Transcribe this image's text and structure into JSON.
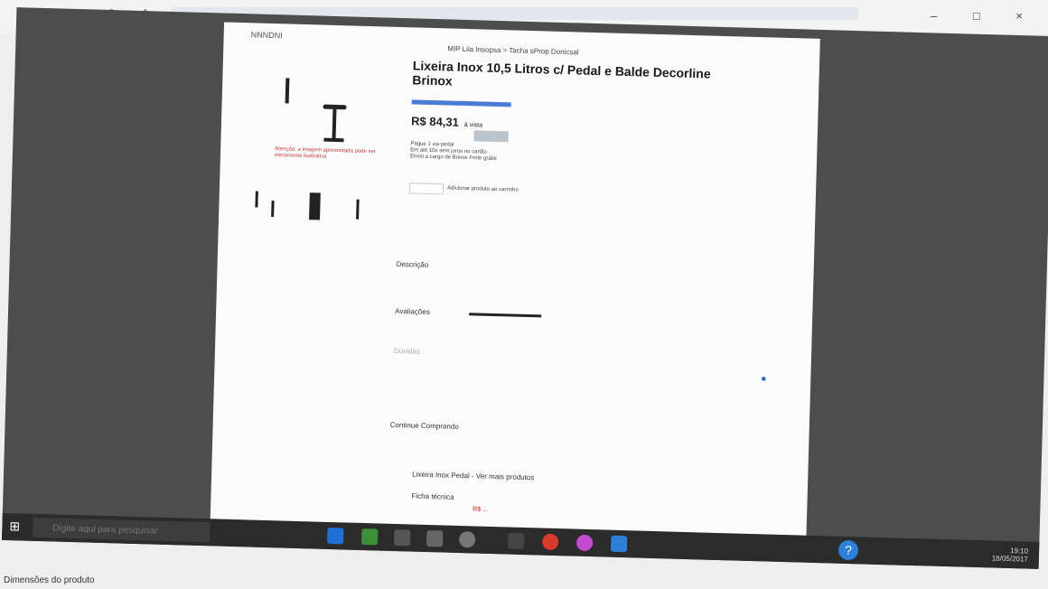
{
  "browser": {
    "reload_icon": "refresh-icon",
    "home_icon": "home-icon",
    "window_controls": [
      "–",
      "□",
      "×"
    ],
    "toolbar_icons": [
      "☆",
      "≡",
      "✎",
      "⇧",
      "…"
    ]
  },
  "page": {
    "header_left": "NNNDNI",
    "breadcrumb": "MIP Lila Insopsa > Tacha sProp Donicsal",
    "title": "Lixeira Inox 10,5 Litros c/ Pedal e Balde Decorline Brinox",
    "price": "R$ 84,31",
    "price_note": "à vista",
    "warning": "Atenção: a imagem apresentada pode ser meramente ilustrativa",
    "specs": [
      "Pague 1 via pedal",
      "Em até 10x sem juros no cartão",
      "Envio a cargo de Brinox Frete grátis"
    ],
    "qty_note": "Adicionar produto ao carrinho",
    "section1": "Descrição",
    "section2": "Avaliações",
    "section3": "Dúvidas",
    "section4": "Continue Comprando",
    "section5": "Lixeira Inox Pedal - Ver mais produtos",
    "section6": "Ficha técnica",
    "red_mark": "R$ ..."
  },
  "taskbar": {
    "start_icon": "windows-icon",
    "search_placeholder": "Digite aqui para pesquisar",
    "apps": [
      "edge",
      "store",
      "explorer",
      "mail",
      "hp",
      "settings",
      "chrome",
      "photos"
    ],
    "help_icon": "?",
    "clock": "19:10",
    "date": "18/05/2017"
  },
  "caption": {
    "text": "Dimensões do produto"
  },
  "colors": {
    "accent": "#2d7fd8",
    "warning": "#c0393f",
    "link": "#4a7bd6"
  }
}
